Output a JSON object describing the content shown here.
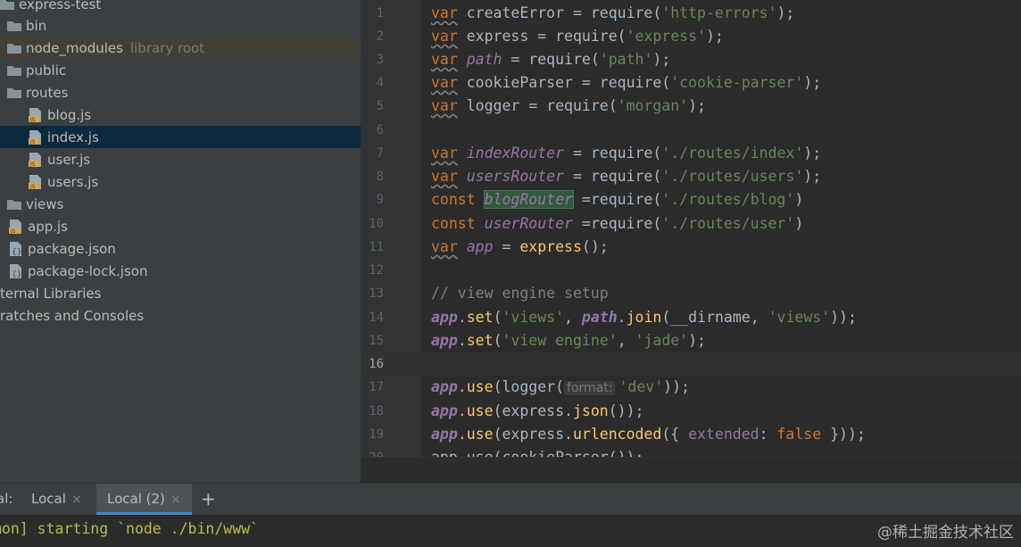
{
  "project_tree": {
    "items": [
      {
        "label": "express-test",
        "type": "folder"
      },
      {
        "label": "bin",
        "type": "folder"
      },
      {
        "label": "node_modules",
        "note": "library root",
        "type": "folder"
      },
      {
        "label": "public",
        "type": "folder"
      },
      {
        "label": "routes",
        "type": "folder"
      },
      {
        "label": "blog.js",
        "type": "js"
      },
      {
        "label": "index.js",
        "type": "js"
      },
      {
        "label": "user.js",
        "type": "js"
      },
      {
        "label": "users.js",
        "type": "js"
      },
      {
        "label": "views",
        "type": "folder"
      },
      {
        "label": "app.js",
        "type": "js"
      },
      {
        "label": "package.json",
        "type": "json"
      },
      {
        "label": "package-lock.json",
        "type": "json"
      },
      {
        "label": "ternal Libraries",
        "type": "lib"
      },
      {
        "label": "ratches and Consoles",
        "type": "lib"
      }
    ]
  },
  "editor": {
    "line_numbers": [
      "1",
      "2",
      "3",
      "4",
      "5",
      "6",
      "7",
      "8",
      "9",
      "10",
      "11",
      "12",
      "13",
      "14",
      "15",
      "16",
      "17",
      "18",
      "19",
      "20"
    ],
    "code": {
      "l1": {
        "var": "var",
        "name": "createError",
        "mid": " = require(",
        "str": "'http-errors'",
        "end": ");"
      },
      "l2": {
        "var": "var",
        "name": "express",
        "mid": " = require(",
        "str": "'express'",
        "end": ");"
      },
      "l3": {
        "var": "var",
        "name": "path",
        "mid": " = require(",
        "str": "'path'",
        "end": ");"
      },
      "l4": {
        "var": "var",
        "name": "cookieParser",
        "mid": " = require(",
        "str": "'cookie-parser'",
        "end": ");"
      },
      "l5": {
        "var": "var",
        "name": "logger",
        "mid": " = require(",
        "str": "'morgan'",
        "end": ");"
      },
      "l7": {
        "var": "var",
        "name": "indexRouter",
        "mid": " = require(",
        "str": "'./routes/index'",
        "end": ");"
      },
      "l8": {
        "var": "var",
        "name": "usersRouter",
        "mid": " = require(",
        "str": "'./routes/users'",
        "end": ");"
      },
      "l9": {
        "kw": "const",
        "name": "blogRouter",
        "mid": " =require(",
        "str": "'./routes/blog'",
        "end": ")"
      },
      "l10": {
        "kw": "const",
        "name": "userRouter",
        "mid": " =require(",
        "str": "'./routes/user'",
        "end": ")"
      },
      "l11": {
        "var": "var",
        "name": "app",
        "mid": " = ",
        "fn": "express",
        "end": "();"
      },
      "l13": {
        "comment": "// view engine setup"
      },
      "l14": {
        "obj": "app",
        "dot": ".",
        "m": "set",
        "a": "(",
        "s1": "'views'",
        "c": ", ",
        "p": "path",
        "dot2": ".",
        "m2": "join",
        "a2": "(__dirname, ",
        "s2": "'views'",
        "end": "));"
      },
      "l15": {
        "obj": "app",
        "dot": ".",
        "m": "set",
        "a": "(",
        "s1": "'view engine'",
        "c": ", ",
        "s2": "'jade'",
        "end": ");"
      },
      "l17": {
        "obj": "app",
        "dot": ".",
        "m": "use",
        "a": "(logger(",
        "hint": "format:",
        "s1": "'dev'",
        "end": "));"
      },
      "l18": {
        "obj": "app",
        "dot": ".",
        "m": "use",
        "a": "(express.",
        "m2": "json",
        "end": "());"
      },
      "l19": {
        "obj": "app",
        "dot": ".",
        "m": "use",
        "a": "(express.",
        "m2": "urlencoded",
        "b": "({ ",
        "k": "extended",
        "colon": ": ",
        "kw": "false",
        "end": " }));"
      },
      "l20": {
        "partial": "app.use(cookieParser());"
      }
    }
  },
  "terminal": {
    "label": "al:",
    "tabs": [
      {
        "label": "Local",
        "close": "×"
      },
      {
        "label": "Local (2)",
        "close": "×"
      }
    ],
    "add": "+",
    "output": "mon] starting `node ./bin/www`"
  },
  "watermark": "@稀土掘金技术社区",
  "colors": {
    "keyword": "#cc7832",
    "string": "#6a8759",
    "global": "#9876aa",
    "function": "#ffc66d",
    "selection": "#0d293e"
  }
}
